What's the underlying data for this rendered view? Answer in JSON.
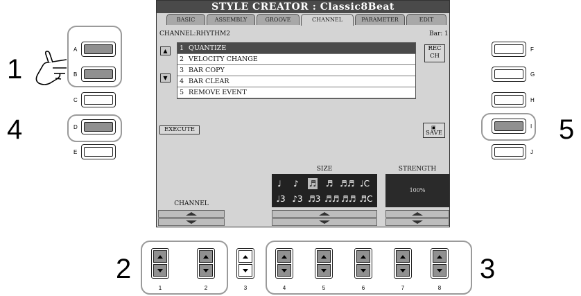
{
  "screen": {
    "title": "STYLE CREATOR : Classic8Beat",
    "tabs": [
      "BASIC",
      "ASSEMBLY",
      "GROOVE",
      "CHANNEL",
      "PARAMETER",
      "EDIT"
    ],
    "active_tab": "CHANNEL",
    "channel_label": "CHANNEL:RHYTHM2",
    "bar_label": "Bar:",
    "bar_value": "1",
    "menu": [
      {
        "num": "1",
        "label": "QUANTIZE",
        "selected": true
      },
      {
        "num": "2",
        "label": "VELOCITY CHANGE",
        "selected": false
      },
      {
        "num": "3",
        "label": "BAR COPY",
        "selected": false
      },
      {
        "num": "4",
        "label": "BAR CLEAR",
        "selected": false
      },
      {
        "num": "5",
        "label": "REMOVE EVENT",
        "selected": false
      }
    ],
    "rec_ch_label": "REC\nCH",
    "execute_label": "EXECUTE",
    "save_label": "SAVE",
    "size_label": "SIZE",
    "strength_label": "STRENGTH",
    "strength_value": "100%",
    "channel_bottom_label": "CHANNEL",
    "size_notes_row1": [
      "♩",
      "♪",
      "♬",
      "♬",
      "♬♬",
      "♩C"
    ],
    "size_notes_row2": [
      "♩3",
      "♪3",
      "♬3",
      "♬♬",
      "♬♬",
      "♬C"
    ]
  },
  "left_buttons": [
    {
      "letter": "A",
      "pressed": true
    },
    {
      "letter": "B",
      "pressed": true
    },
    {
      "letter": "C",
      "pressed": false
    },
    {
      "letter": "D",
      "pressed": true
    },
    {
      "letter": "E",
      "pressed": false
    }
  ],
  "right_buttons": [
    {
      "letter": "F",
      "pressed": false
    },
    {
      "letter": "G",
      "pressed": false
    },
    {
      "letter": "H",
      "pressed": false
    },
    {
      "letter": "I",
      "pressed": true
    },
    {
      "letter": "J",
      "pressed": false
    }
  ],
  "bottom_buttons": [
    "1",
    "2",
    "3",
    "4",
    "5",
    "6",
    "7",
    "8"
  ],
  "step_labels": {
    "s1": "1",
    "s2": "2",
    "s3": "3",
    "s4": "4",
    "s5": "5"
  },
  "colors": {
    "screen_bg": "#d4d4d4",
    "title_bg": "#4a4a4a",
    "pressed": "#909090",
    "ring": "#9a9a9a"
  }
}
